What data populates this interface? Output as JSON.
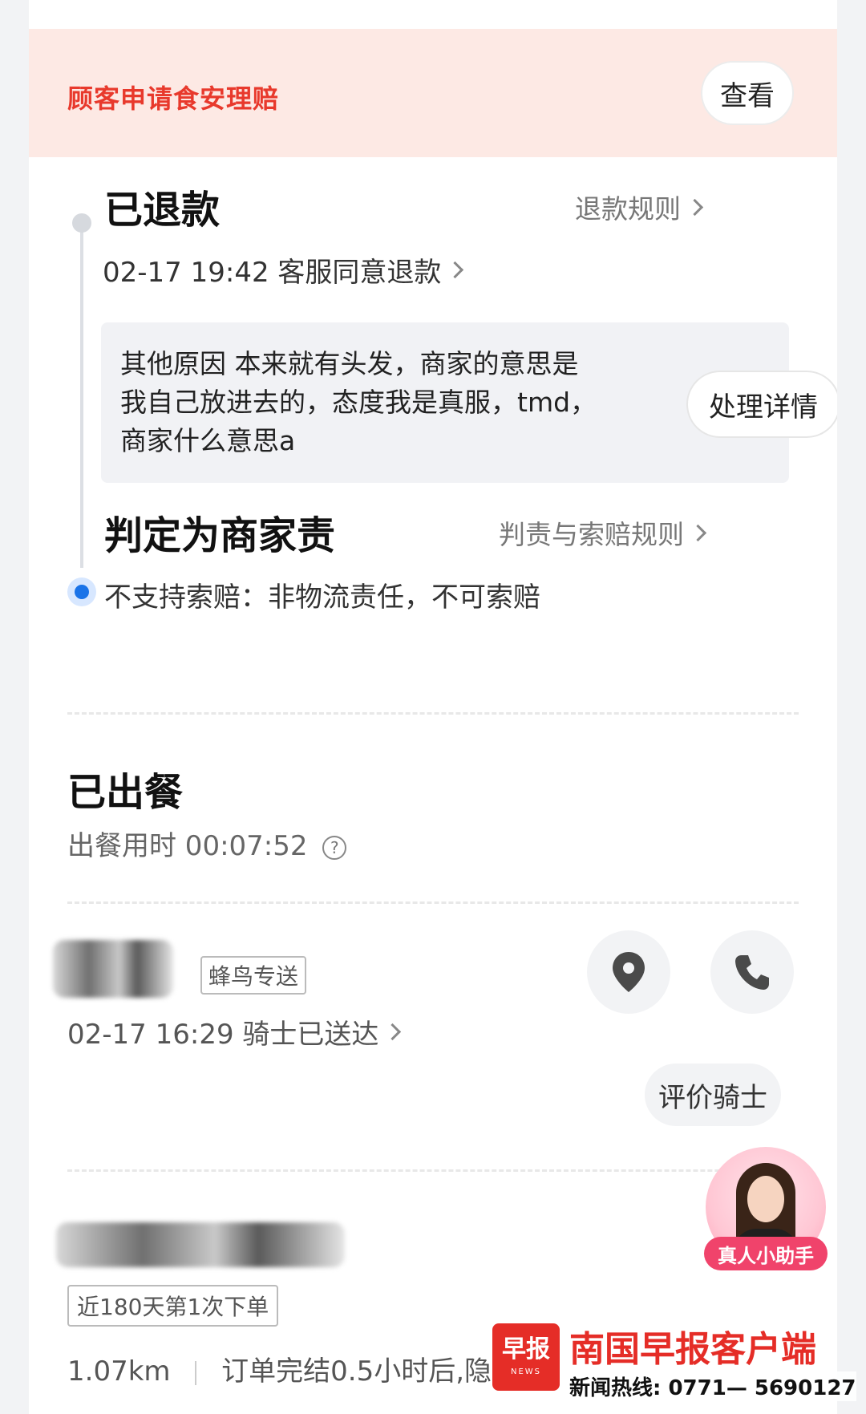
{
  "banner": {
    "text": "顾客申请食安理赔",
    "view_label": "查看"
  },
  "refund": {
    "title": "已退款",
    "rule_link": "退款规则",
    "event": "02-17 19:42 客服同意退款",
    "reason": "其他原因 本来就有头发，商家的意思是我自己放进去的，态度我是真服，tmd，商家什么意思a",
    "detail_button": "处理详情"
  },
  "judgement": {
    "title": "判定为商家责",
    "rule_link": "判责与索赔规则",
    "note": "不支持索赔：非物流责任，不可索赔"
  },
  "meal": {
    "title": "已出餐",
    "time_label": "出餐用时 00:07:52",
    "help_icon": "?"
  },
  "delivery": {
    "courier_tag": "蜂鸟专送",
    "event": "02-17 16:29 骑士已送达",
    "rate_button": "评价骑士",
    "location_icon": "location-pin",
    "phone_icon": "phone"
  },
  "assistant": {
    "label": "真人小助手"
  },
  "customer": {
    "order_tag": "近180天第1次下单",
    "distance": "1.07km",
    "note": "订单完结0.5小时后,隐藏"
  },
  "watermark": {
    "logo_text": "早报",
    "logo_sub": "NEWS",
    "title": "南国早报客户端",
    "hotline": "新闻热线: 0771— 5690127"
  },
  "colors": {
    "brand_red": "#e8392c",
    "timeline_blue": "#1a73e8",
    "banner_bg": "#fde9e4"
  }
}
